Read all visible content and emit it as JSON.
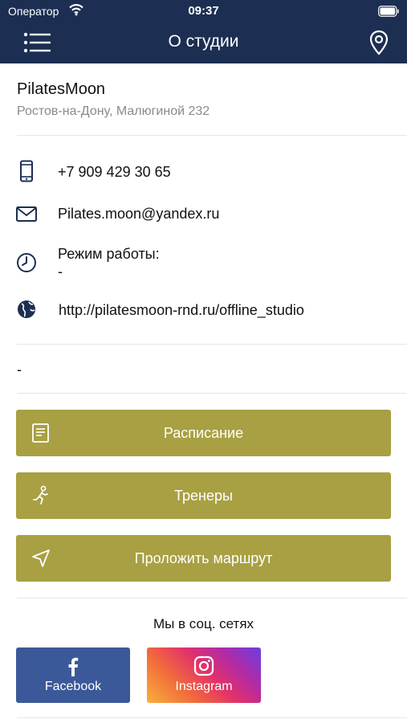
{
  "status_bar": {
    "carrier": "Оператор",
    "time": "09:37",
    "wifi_icon": "wifi-icon",
    "battery_icon": "battery-icon"
  },
  "nav": {
    "title": "О студии",
    "menu_icon": "hamburger-menu-icon",
    "map_icon": "map-pin-icon"
  },
  "studio": {
    "name": "PilatesMoon",
    "address": "Ростов-на-Дону, Малюгиной 232"
  },
  "contacts": {
    "phone": "+7 909 429 30 65",
    "email": "Pilates.moon@yandex.ru",
    "hours_label": "Режим работы:",
    "hours_value": "-",
    "website": "http://pilatesmoon-rnd.ru/offline_studio"
  },
  "description": "-",
  "actions": {
    "schedule": "Расписание",
    "trainers": "Тренеры",
    "route": "Проложить маршрут"
  },
  "social": {
    "title": "Мы в соц. сетях",
    "facebook": "Facebook",
    "instagram": "Instagram"
  },
  "colors": {
    "nav_background": "#1c2f52",
    "button_gold": "#a8a043",
    "facebook_blue": "#3b5998",
    "icon_navy": "#1c2f52"
  }
}
